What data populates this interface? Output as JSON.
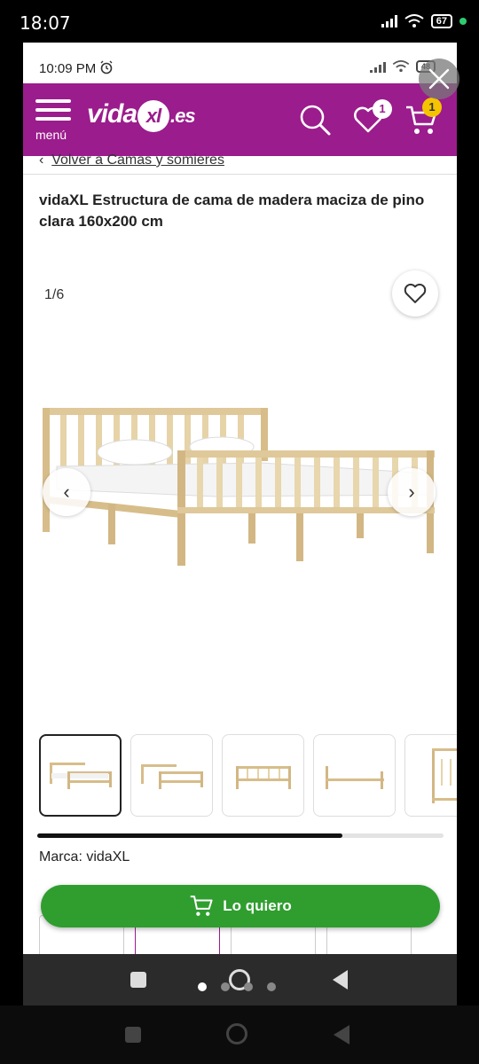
{
  "outer_status": {
    "time": "18:07",
    "battery": "67"
  },
  "inner_status": {
    "time": "10:09 PM",
    "battery": "48"
  },
  "header": {
    "menu_label": "menú",
    "logo_left": "vida",
    "logo_mark": "xl",
    "logo_right": ".es",
    "wishlist_count": "1",
    "cart_count": "1",
    "brand_color": "#9b1c8c"
  },
  "breadcrumb": {
    "chevron": "‹",
    "link": "Volver a Camas y somieres"
  },
  "product": {
    "title": "vidaXL Estructura de cama de madera maciza de pino clara 160x200 cm",
    "image_counter": "1/6",
    "brand": "Marca: vidaXL",
    "scroll_fraction": 0.75
  },
  "gallery": {
    "prev": "‹",
    "next": "›",
    "thumb_count": 5,
    "active_index": 0
  },
  "cta": {
    "label": "Lo quiero",
    "color": "#2f9e2f"
  },
  "icons": [
    "menu-icon",
    "search-icon",
    "heart-icon",
    "cart-icon",
    "close-icon",
    "chevron-left-icon",
    "chevron-right-icon"
  ]
}
